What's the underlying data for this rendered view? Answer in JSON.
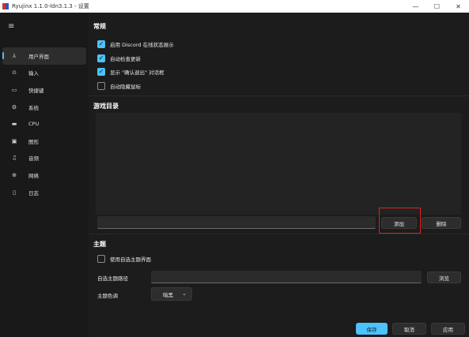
{
  "window": {
    "title": "Ryujinx 1.1.0-ldn3.1.3 - 设置",
    "controls": {
      "minimize": "—",
      "maximize": "☐",
      "close": "✕"
    }
  },
  "sidebar": {
    "menu_glyph": "≡",
    "items": [
      {
        "label": "用户界面",
        "icon": "ui-icon",
        "glyph": "⅄",
        "active": true
      },
      {
        "label": "输入",
        "icon": "gamepad-icon",
        "glyph": "⊙"
      },
      {
        "label": "快捷键",
        "icon": "keyboard-icon",
        "glyph": "▭"
      },
      {
        "label": "系统",
        "icon": "gear-icon",
        "glyph": "⚙"
      },
      {
        "label": "CPU",
        "icon": "cpu-icon",
        "glyph": "▬"
      },
      {
        "label": "图形",
        "icon": "image-icon",
        "glyph": "▣"
      },
      {
        "label": "音频",
        "icon": "music-icon",
        "glyph": "♫"
      },
      {
        "label": "网络",
        "icon": "globe-icon",
        "glyph": "⊕"
      },
      {
        "label": "日志",
        "icon": "document-icon",
        "glyph": "▯"
      }
    ]
  },
  "general": {
    "title": "常规",
    "options": [
      {
        "label": "启用 Discord 在线状态展示",
        "checked": true
      },
      {
        "label": "自动检查更新",
        "checked": true
      },
      {
        "label": "显示 \"确认退出\" 对话框",
        "checked": true
      },
      {
        "label": "自动隐藏鼠标",
        "checked": false
      }
    ]
  },
  "game_dirs": {
    "title": "游戏目录",
    "path_value": "",
    "add_label": "添加",
    "remove_label": "删除"
  },
  "theme": {
    "title": "主题",
    "custom_label": "使用自选主题界面",
    "custom_checked": false,
    "path_label": "自选主题路径",
    "path_value": "",
    "browse_label": "浏览",
    "color_label": "主题色调",
    "color_value": "暗黑",
    "chevron": "⌄"
  },
  "footer": {
    "save_label": "保存",
    "cancel_label": "取消",
    "apply_label": "应用"
  },
  "colors": {
    "accent": "#4cc2ff",
    "highlight": "#e02020"
  }
}
